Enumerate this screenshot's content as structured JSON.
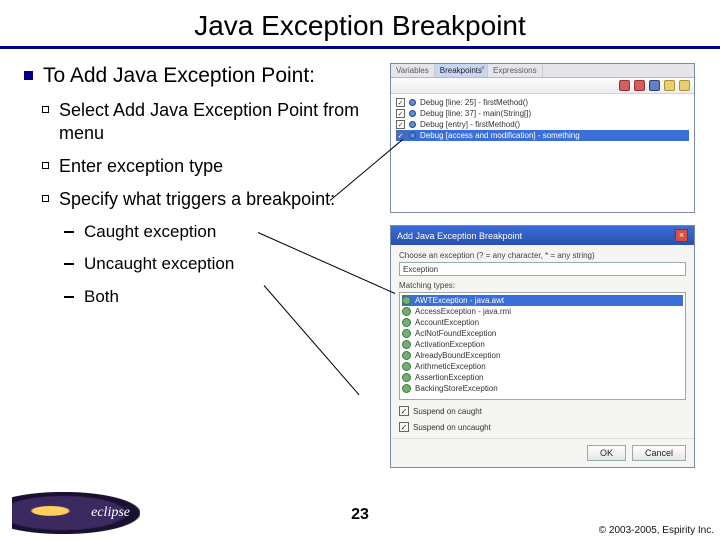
{
  "title": "Java Exception Breakpoint",
  "main": {
    "heading": "To Add Java Exception Point:",
    "steps": [
      "Select Add Java Exception Point from menu",
      "Enter exception type",
      "Specify what triggers a breakpoint:"
    ],
    "triggers": [
      "Caught exception",
      "Uncaught exception",
      "Both"
    ]
  },
  "breakpoints_view": {
    "tabs": [
      "Variables",
      "Breakpoints",
      "Expressions"
    ],
    "active_tab": 1,
    "items": [
      "Debug [line: 25] - firstMethod()",
      "Debug [line: 37] - main(String[])",
      "Debug [entry] - firstMethod()",
      "Debug [access and modification] - something"
    ],
    "selected": 3
  },
  "dialog": {
    "title": "Add Java Exception Breakpoint",
    "prompt": "Choose an exception (? = any character, * = any string)",
    "input_value": "Exception",
    "matches_label": "Matching types:",
    "matches": [
      "AWTException - java.awt",
      "AccessException - java.rmi",
      "AccountException",
      "AclNotFoundException",
      "ActivationException",
      "AlreadyBoundException",
      "ArithmeticException",
      "AssertionException",
      "BackingStoreException"
    ],
    "checks": [
      {
        "label": "Suspend on caught",
        "checked": true
      },
      {
        "label": "Suspend on uncaught",
        "checked": true
      }
    ],
    "buttons": {
      "ok": "OK",
      "cancel": "Cancel"
    }
  },
  "footer": {
    "logo_text": "eclipse",
    "page": "23",
    "copyright": "© 2003-2005, Espirity Inc."
  }
}
